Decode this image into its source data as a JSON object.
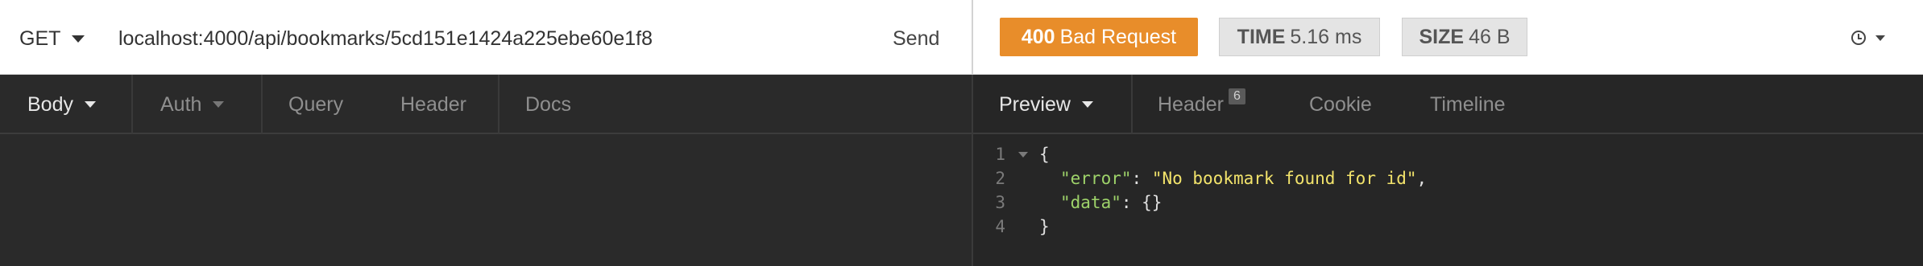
{
  "request": {
    "method": "GET",
    "url": "localhost:4000/api/bookmarks/5cd151e1424a225ebe60e1f8",
    "send_label": "Send"
  },
  "response": {
    "status_code": "400",
    "status_text": "Bad Request",
    "status_color": "#e88d2a",
    "time_label": "TIME",
    "time_value": "5.16 ms",
    "size_label": "SIZE",
    "size_value": "46 B",
    "history_icon": "clock-icon"
  },
  "request_tabs": [
    {
      "label": "Body",
      "active": true,
      "has_dropdown": true
    },
    {
      "label": "Auth",
      "active": false,
      "has_dropdown": true
    },
    {
      "label": "Query",
      "active": false
    },
    {
      "label": "Header",
      "active": false
    },
    {
      "label": "Docs",
      "active": false
    }
  ],
  "response_tabs": [
    {
      "label": "Preview",
      "active": true,
      "has_dropdown": true
    },
    {
      "label": "Header",
      "active": false,
      "badge": "6"
    },
    {
      "label": "Cookie",
      "active": false
    },
    {
      "label": "Timeline",
      "active": false
    }
  ],
  "preview": {
    "lines": [
      {
        "num": "1",
        "text": "{"
      },
      {
        "num": "2",
        "key": "\"error\"",
        "sep": ": ",
        "value": "\"No bookmark found for id\"",
        "tail": ","
      },
      {
        "num": "3",
        "key": "\"data\"",
        "sep": ": ",
        "value": "{}"
      },
      {
        "num": "4",
        "text": "}"
      }
    ]
  }
}
